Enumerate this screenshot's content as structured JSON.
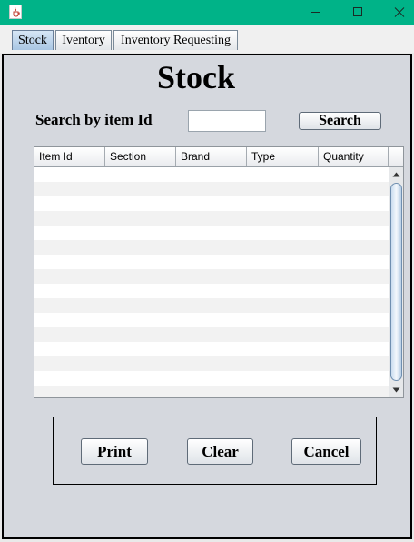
{
  "window": {
    "icon": "java-cup-icon",
    "controls": [
      "minimize-icon",
      "maximize-icon",
      "close-icon"
    ],
    "accent_color": "#00b388"
  },
  "tabs": [
    {
      "label": "Stock",
      "active": true
    },
    {
      "label": "Iventory",
      "active": false
    },
    {
      "label": "Inventory Requesting",
      "active": false
    }
  ],
  "stock": {
    "title": "Stock",
    "search_label": "Search by item Id",
    "search_value": "",
    "search_button": "Search",
    "table": {
      "columns": [
        "Item Id",
        "Section",
        "Brand",
        "Type",
        "Quantity"
      ],
      "rows": []
    },
    "actions": {
      "print": "Print",
      "clear": "Clear",
      "cancel": "Cancel"
    }
  }
}
